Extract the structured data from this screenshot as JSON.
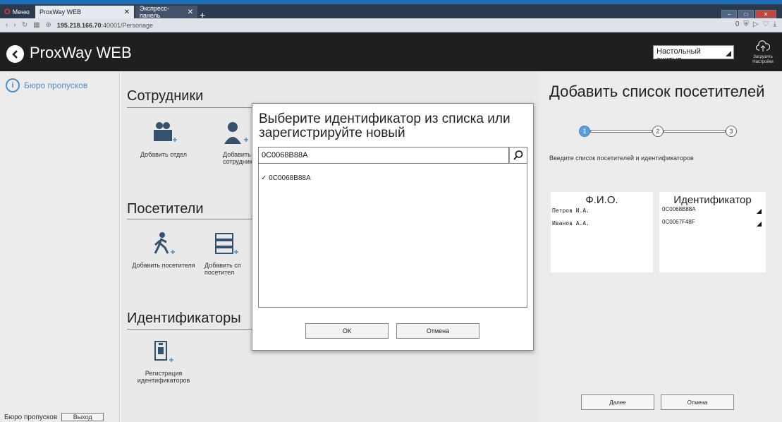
{
  "browser": {
    "menu_label": "Меню",
    "tabs": [
      {
        "label": "ProxWay WEB"
      },
      {
        "label": "Экспресс-панель"
      }
    ],
    "url_host": "195.218.166.70",
    "url_path": ":40001/Personage",
    "counter": "0"
  },
  "header": {
    "title": "ProxWay WEB",
    "reader_select": "Настольный считыв...",
    "load_settings": "Загрузить Настройки"
  },
  "sidebar": {
    "item_label": "Бюро пропусков",
    "footer_label": "Бюро пропусков",
    "logout_label": "Выход"
  },
  "main": {
    "sections": [
      {
        "title": "Сотрудники",
        "tiles": [
          "Добавить отдел",
          "Добавить сотрудник"
        ]
      },
      {
        "title": "Посетители",
        "tiles": [
          "Добавить посетителя",
          "Добавить сп посетител"
        ]
      },
      {
        "title": "Идентификаторы",
        "tiles": [
          "Регистрация идентификаторов"
        ]
      }
    ]
  },
  "dialog": {
    "title": "Выберите идентификатор из списка или зарегистрируйте новый",
    "search_value": "0C0068B88A",
    "items": [
      {
        "label": "✓ 0C0068B88A"
      }
    ],
    "ok_label": "ОК",
    "cancel_label": "Отмена"
  },
  "right_panel": {
    "title": "Добавить список посетителей",
    "steps": [
      "1",
      "2",
      "3"
    ],
    "active_step": 1,
    "hint": "Введите список посетителей и идентификаторов",
    "col_fio": "Ф.И.О.",
    "col_id": "Идентификатор",
    "rows": [
      {
        "fio": "Петров И.А.",
        "id": "0C0068B88A"
      },
      {
        "fio": "Иванов А.А.",
        "id": "0C0067F48F"
      }
    ],
    "next_label": "Далее",
    "cancel_label": "Отмена"
  },
  "colors": {
    "accent": "#4e8ec7",
    "header_bg": "#1f1f1f",
    "step_active": "#5aa0dc"
  }
}
